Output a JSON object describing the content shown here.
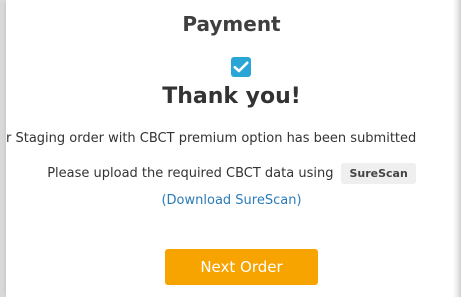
{
  "header": {
    "title": "Payment"
  },
  "confirmation": {
    "checkbox_checked": true,
    "heading": "Thank you!",
    "message": "er Staging order with CBCT premium option has been submitted",
    "upload_prefix": "Please upload the required CBCT data using",
    "tool_tag": "SureScan",
    "download_link": "(Download SureScan)"
  },
  "actions": {
    "next_order_label": "Next Order"
  },
  "colors": {
    "accent_blue": "#2aa6d6",
    "link_blue": "#2a7bb8",
    "primary_button": "#f7a400",
    "tag_background": "#efefef"
  },
  "icons": {
    "success": "checkmark-icon"
  }
}
